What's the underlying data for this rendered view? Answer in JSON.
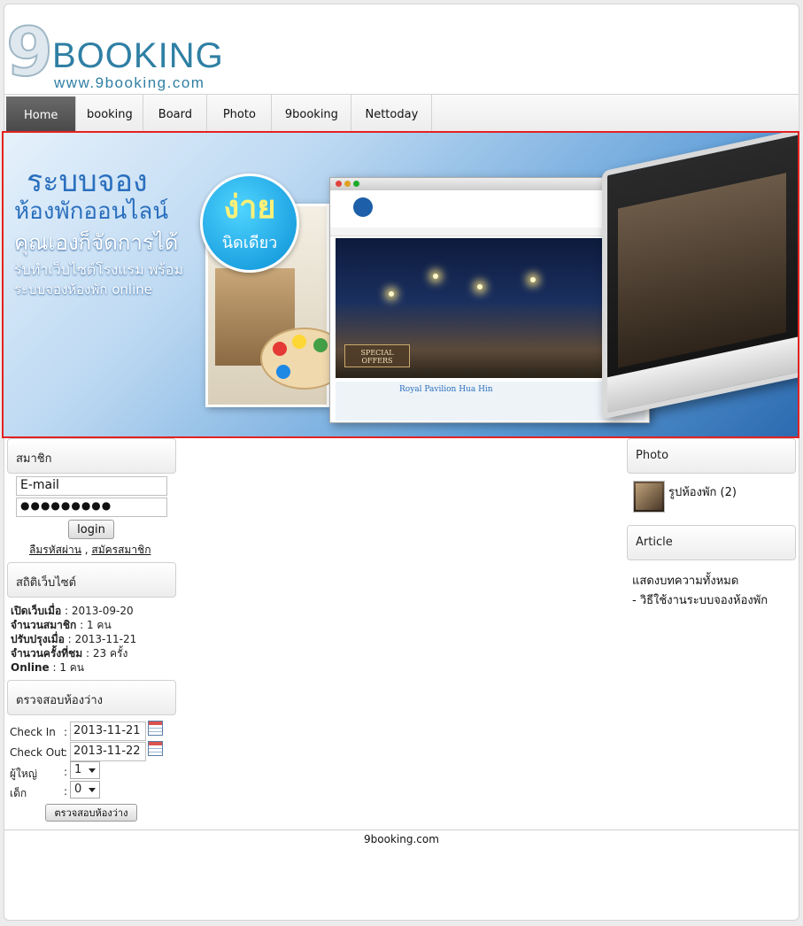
{
  "logo": {
    "nine": "9",
    "word": "BOOKING",
    "url": "www.9booking.com"
  },
  "nav": [
    "Home",
    "booking",
    "Board",
    "Photo",
    "9booking",
    "Nettoday"
  ],
  "banner": {
    "line1": "ระบบจอง",
    "line2": "ห้องพักออนไลน์",
    "line3": "คุณเองก็จัดการได้",
    "line4": "รับทำเว็บไซต์โรงแรม พร้อม",
    "line5": "ระบบจองห้องพัก online",
    "badge1": "ง่าย",
    "badge2": "นิดเดียว",
    "offer": "SPECIAL OFFERS",
    "site": "Royal Pavilion Hua Hin"
  },
  "member": {
    "title": "สมาชิก",
    "email": "E-mail",
    "password": "●●●●●●●●●",
    "login": "login",
    "forgot": "ลืมรหัสผ่าน",
    "sep": " , ",
    "register": "สมัครสมาชิก"
  },
  "stats": {
    "title": "สถิติเว็บไซต์",
    "items": [
      {
        "label": "เปิดเว็บเมื่อ",
        "value": " : 2013-09-20"
      },
      {
        "label": "จำนวนสมาชิก",
        "value": " : 1 คน"
      },
      {
        "label": "ปรับปรุงเมื่อ",
        "value": " : 2013-11-21"
      },
      {
        "label": "จำนวนครั้งที่ชม",
        "value": " : 23 ครั้ง"
      },
      {
        "label": "Online",
        "value": " : 1 คน"
      }
    ]
  },
  "check": {
    "title": "ตรวจสอบห้องว่าง",
    "checkin_label": "Check In",
    "checkin": "2013-11-21",
    "checkout_label": "Check Out",
    "checkout": "2013-11-22",
    "adult_label": "ผู้ใหญ่",
    "adult": "1",
    "child_label": "เด็ก",
    "child": "0",
    "colon": ":",
    "button": "ตรวจสอบห้องว่าง"
  },
  "photo": {
    "title": "Photo",
    "album": "รูปห้องพัก (2)"
  },
  "article": {
    "title": "Article",
    "all": "แสดงบทความทั้งหมด",
    "item": "- วิธีใช้งานระบบจองห้องพัก"
  },
  "footer": "9booking.com"
}
